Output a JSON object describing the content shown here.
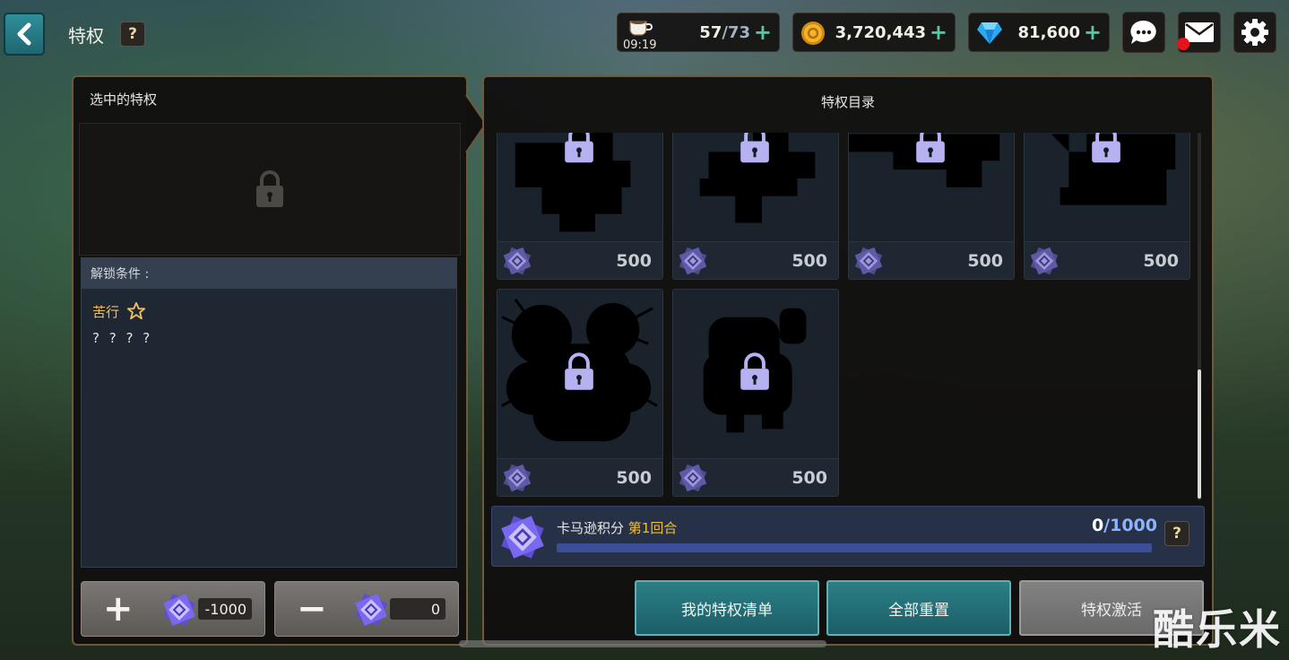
{
  "header": {
    "title": "特权",
    "help_label": "?",
    "stamina": {
      "current": "57",
      "max": "73",
      "timer": "09:19"
    },
    "gold": "3,720,443",
    "gems": "81,600",
    "plus": "+"
  },
  "left_panel": {
    "title": "选中的特权",
    "unlock_header": "解锁条件 :",
    "condition_name": "苦行",
    "condition_desc": "? ? ? ?",
    "add_value": "-1000",
    "remove_value": "0"
  },
  "catalog": {
    "title": "特权目录",
    "cards": [
      {
        "cost": "500"
      },
      {
        "cost": "500"
      },
      {
        "cost": "500"
      },
      {
        "cost": "500"
      },
      {
        "cost": "500"
      },
      {
        "cost": "500"
      }
    ],
    "score": {
      "label": "卡马逊积分",
      "round": "第1回合",
      "current": "0",
      "max": "/1000",
      "progress": 0
    }
  },
  "buttons": {
    "my_list": "我的特权清单",
    "reset_all": "全部重置",
    "activate": "特权激活"
  },
  "watermark": "酷乐米",
  "colors": {
    "accent_teal": "#2b7f86",
    "gold_text": "#f0c060",
    "score_blue": "#8fb2ff",
    "plus_green": "#4fc9a6"
  }
}
